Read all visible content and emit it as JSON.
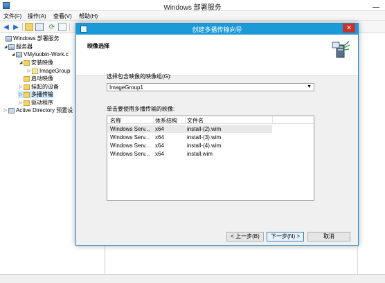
{
  "main_window": {
    "title": "Windows 部署服务"
  },
  "menu": {
    "file": "文件(F)",
    "action": "操作(A)",
    "view": "查看(V)",
    "help": "帮助(H)"
  },
  "tree": {
    "items": [
      {
        "label": "Windows 部署服务"
      },
      {
        "label": "服务器"
      },
      {
        "label": "VMyluobin-Work.c"
      },
      {
        "label": "安装映像"
      },
      {
        "label": "ImageGroup"
      },
      {
        "label": "启动映像"
      },
      {
        "label": "挂起的设备"
      },
      {
        "label": "多播传输"
      },
      {
        "label": "驱动程序"
      },
      {
        "label": "Active Directory 预置设"
      }
    ]
  },
  "dialog": {
    "title": "创建多播传输向导",
    "header": "映像选择",
    "group_label": "选择包含映像的映像组(G):",
    "group_value": "ImageGroup1",
    "images_label": "单击要使用多播传输的映像:",
    "columns": [
      "名称",
      "体系结构",
      "文件名"
    ],
    "rows": [
      {
        "name": "Windows Serv...",
        "arch": "x64",
        "file": "install-(2).wim"
      },
      {
        "name": "Windows Serv...",
        "arch": "x64",
        "file": "install-(3).wim"
      },
      {
        "name": "Windows Serv...",
        "arch": "x64",
        "file": "install-(4).wim"
      },
      {
        "name": "Windows Serv...",
        "arch": "x64",
        "file": "install.wim"
      }
    ],
    "buttons": {
      "back": "< 上一步(B)",
      "next": "下一步(N) >",
      "cancel": "取消"
    }
  },
  "colors": {
    "dialog_title_bg": "#1b9ad8",
    "close_button_bg": "#c7312b",
    "selection": "#cce8ff"
  }
}
